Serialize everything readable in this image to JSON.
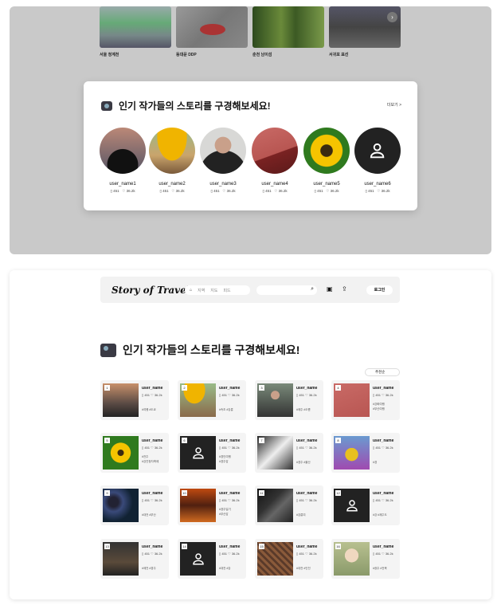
{
  "places": [
    {
      "label": "서울 청계천"
    },
    {
      "label": "동대문 DDP"
    },
    {
      "label": "춘천 남이섬"
    },
    {
      "label": "서귀포 표선"
    }
  ],
  "popular": {
    "title": "인기 작가들의 스토리를 구경해보세요!",
    "more": "더보기 >",
    "authors": [
      {
        "name": "user_name1",
        "posts": "451",
        "likes": "36.2k"
      },
      {
        "name": "user_name2",
        "posts": "451",
        "likes": "36.2k"
      },
      {
        "name": "user_name3",
        "posts": "451",
        "likes": "36.2k"
      },
      {
        "name": "user_name4",
        "posts": "451",
        "likes": "36.2k"
      },
      {
        "name": "user_name5",
        "posts": "451",
        "likes": "36.2k"
      },
      {
        "name": "user_name6",
        "posts": "451",
        "likes": "36.2k"
      }
    ]
  },
  "nav": {
    "logo": "Story of Travel",
    "menu": [
      "지역",
      "지도",
      "피드"
    ],
    "login": "로그인"
  },
  "section": {
    "title": "인기 작가들의 스토리를 구경해보세요!",
    "sort": "추천순"
  },
  "grid": [
    {
      "num": "1",
      "name": "user_name",
      "posts": "451",
      "likes": "36.2k",
      "tags": [
        "#여행 #도쿄"
      ]
    },
    {
      "num": "2",
      "name": "user_name",
      "posts": "451",
      "likes": "36.2k",
      "tags": [
        "#속초 #강릉"
      ]
    },
    {
      "num": "3",
      "name": "user_name",
      "posts": "451",
      "likes": "36.2k",
      "tags": [
        "#제주 #오름"
      ]
    },
    {
      "num": "4",
      "name": "user_name",
      "posts": "451",
      "likes": "36.2k",
      "tags": [
        "#강화여행",
        "#부산여행"
      ]
    },
    {
      "num": "5",
      "name": "user_name",
      "posts": "451",
      "likes": "36.2k",
      "tags": [
        "#전주",
        "#강진청자축제"
      ]
    },
    {
      "num": "6",
      "name": "user_name",
      "posts": "451",
      "likes": "36.2k",
      "tags": [
        "#경인여행",
        "#경주감"
      ]
    },
    {
      "num": "7",
      "name": "user_name",
      "posts": "451",
      "likes": "36.2k",
      "tags": [
        "#경주 #울산"
      ]
    },
    {
      "num": "8",
      "name": "user_name",
      "posts": "451",
      "likes": "36.2k",
      "tags": [
        "#경"
      ]
    },
    {
      "num": "9",
      "name": "user_name",
      "posts": "451",
      "likes": "36.2k",
      "tags": [
        "#대전 #부산"
      ]
    },
    {
      "num": "10",
      "name": "user_name",
      "posts": "451",
      "likes": "36.2k",
      "tags": [
        "#경주일기",
        "#부산감"
      ]
    },
    {
      "num": "11",
      "name": "user_name",
      "posts": "451",
      "likes": "36.2k",
      "tags": [
        "#강릉여"
      ]
    },
    {
      "num": "12",
      "name": "user_name",
      "posts": "451",
      "likes": "36.2k",
      "tags": [
        "#강 #제주도"
      ]
    },
    {
      "num": "13",
      "name": "user_name",
      "posts": "451",
      "likes": "36.2k",
      "tags": [
        "#제천 #경주"
      ]
    },
    {
      "num": "14",
      "name": "user_name",
      "posts": "451",
      "likes": "36.2k",
      "tags": [
        "#대전 #강"
      ]
    },
    {
      "num": "15",
      "name": "user_name",
      "posts": "451",
      "likes": "36.2k",
      "tags": [
        "#대전 #인천"
      ]
    },
    {
      "num": "16",
      "name": "user_name",
      "posts": "451",
      "likes": "36.2k",
      "tags": [
        "#광주 #전북"
      ]
    }
  ]
}
